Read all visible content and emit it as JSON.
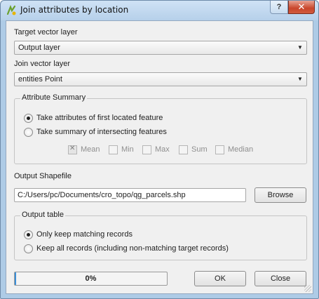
{
  "window": {
    "title": "Join attributes by location",
    "help_glyph": "?",
    "close_glyph": "✕",
    "icon": "qgis-icon"
  },
  "target_layer": {
    "label": "Target vector layer",
    "value": "Output layer"
  },
  "join_layer": {
    "label": "Join vector layer",
    "value": "entities Point"
  },
  "attribute_summary": {
    "title": "Attribute Summary",
    "options": [
      {
        "label": "Take attributes of first located feature",
        "checked": true
      },
      {
        "label": "Take summary of intersecting features",
        "checked": false
      }
    ],
    "stats": [
      {
        "label": "Mean",
        "checked": true
      },
      {
        "label": "Min",
        "checked": false
      },
      {
        "label": "Max",
        "checked": false
      },
      {
        "label": "Sum",
        "checked": false
      },
      {
        "label": "Median",
        "checked": false
      }
    ]
  },
  "output": {
    "label": "Output Shapefile",
    "path": "C:/Users/pc/Documents/cro_topo/qg_parcels.shp",
    "browse_label": "Browse"
  },
  "output_table": {
    "title": "Output table",
    "options": [
      {
        "label": "Only keep matching records",
        "checked": true
      },
      {
        "label": "Keep all records (including non-matching target records)",
        "checked": false
      }
    ]
  },
  "progress": {
    "value": 0,
    "text": "0%"
  },
  "buttons": {
    "ok_label": "OK",
    "close_label": "Close"
  },
  "colors": {
    "progress_fill": "#3b8fd8",
    "window_frame": "#aecbe6"
  }
}
